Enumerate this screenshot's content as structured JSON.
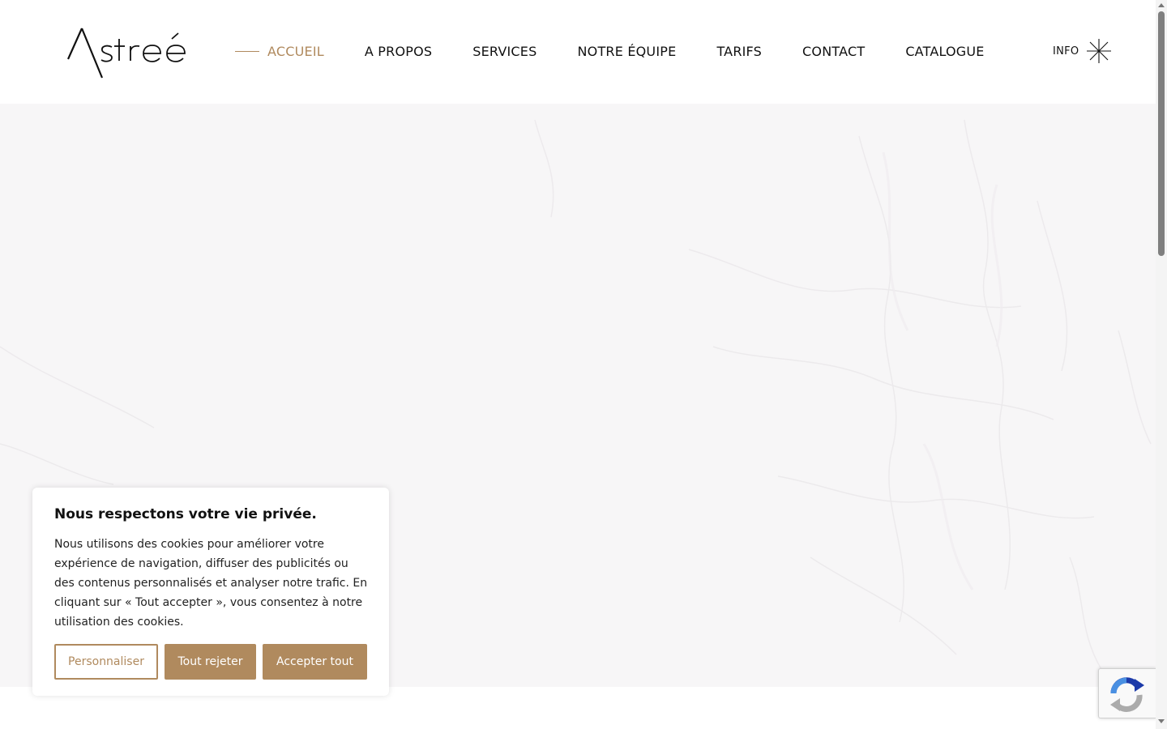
{
  "header": {
    "logo_text": "Astrée",
    "nav": [
      {
        "label": "ACCUEIL",
        "active": true
      },
      {
        "label": "A PROPOS"
      },
      {
        "label": "SERVICES"
      },
      {
        "label": "NOTRE ÉQUIPE"
      },
      {
        "label": "TARIFS"
      },
      {
        "label": "CONTACT"
      },
      {
        "label": "CATALOGUE"
      }
    ],
    "info_label": "INFO",
    "info_icon": "asterisk-star-icon"
  },
  "cookie_banner": {
    "title": "Nous respectons votre vie privée.",
    "text": "Nous utilisons des cookies pour améliorer votre expérience de navigation, diffuser des publicités ou des contenus personnalisés et analyser notre trafic. En cliquant sur « Tout accepter », vous consentez à notre utilisation des cookies.",
    "buttons": {
      "customize": "Personnaliser",
      "reject": "Tout rejeter",
      "accept": "Accepter tout"
    }
  },
  "recaptcha": {
    "icon": "recaptcha-icon"
  },
  "colors": {
    "accent": "#b08a5e",
    "text": "#111111",
    "hero_background": "#f7f6f7"
  }
}
